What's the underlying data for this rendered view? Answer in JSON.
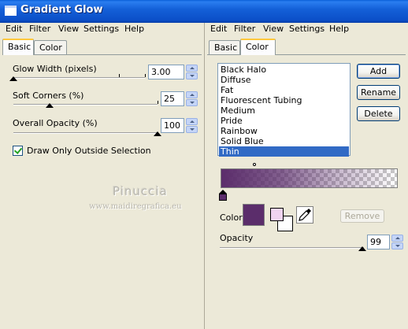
{
  "window": {
    "title": "Gradient Glow"
  },
  "left": {
    "menu": [
      "Edit",
      "Filter",
      "View",
      "Settings",
      "Help"
    ],
    "tabs": [
      "Basic",
      "Color"
    ],
    "active_tab": "Basic",
    "glow_width": {
      "label": "Glow Width (pixels)",
      "value": "3.00",
      "level": 0.03
    },
    "soft_corners": {
      "label": "Soft Corners (%)",
      "value": "25",
      "level": 0.25
    },
    "overall_opacity": {
      "label": "Overall Opacity (%)",
      "value": "100",
      "level": 1.0
    },
    "draw_outside": {
      "label": "Draw Only Outside Selection",
      "checked": true
    },
    "watermark": {
      "name": "Pinuccia",
      "url": "www.maidiregrafica.eu"
    }
  },
  "right": {
    "menu": [
      "Edit",
      "Filter",
      "View",
      "Settings",
      "Help"
    ],
    "tabs": [
      "Basic",
      "Color"
    ],
    "active_tab": "Color",
    "presets": [
      "Black Halo",
      "Diffuse",
      "Fat",
      "Fluorescent Tubing",
      "Medium",
      "Pride",
      "Rainbow",
      "Solid Blue",
      "Thin"
    ],
    "selected_preset": "Thin",
    "buttons": {
      "add": "Add",
      "rename": "Rename",
      "delete": "Delete",
      "remove": "Remove"
    },
    "color_label": "Color",
    "opacity": {
      "label": "Opacity",
      "value": "99",
      "level": 0.99
    },
    "colors": {
      "glow": "#5b2d6b",
      "swatch_fg": "#f0d4f0",
      "swatch_bg": "#ffffff"
    }
  }
}
